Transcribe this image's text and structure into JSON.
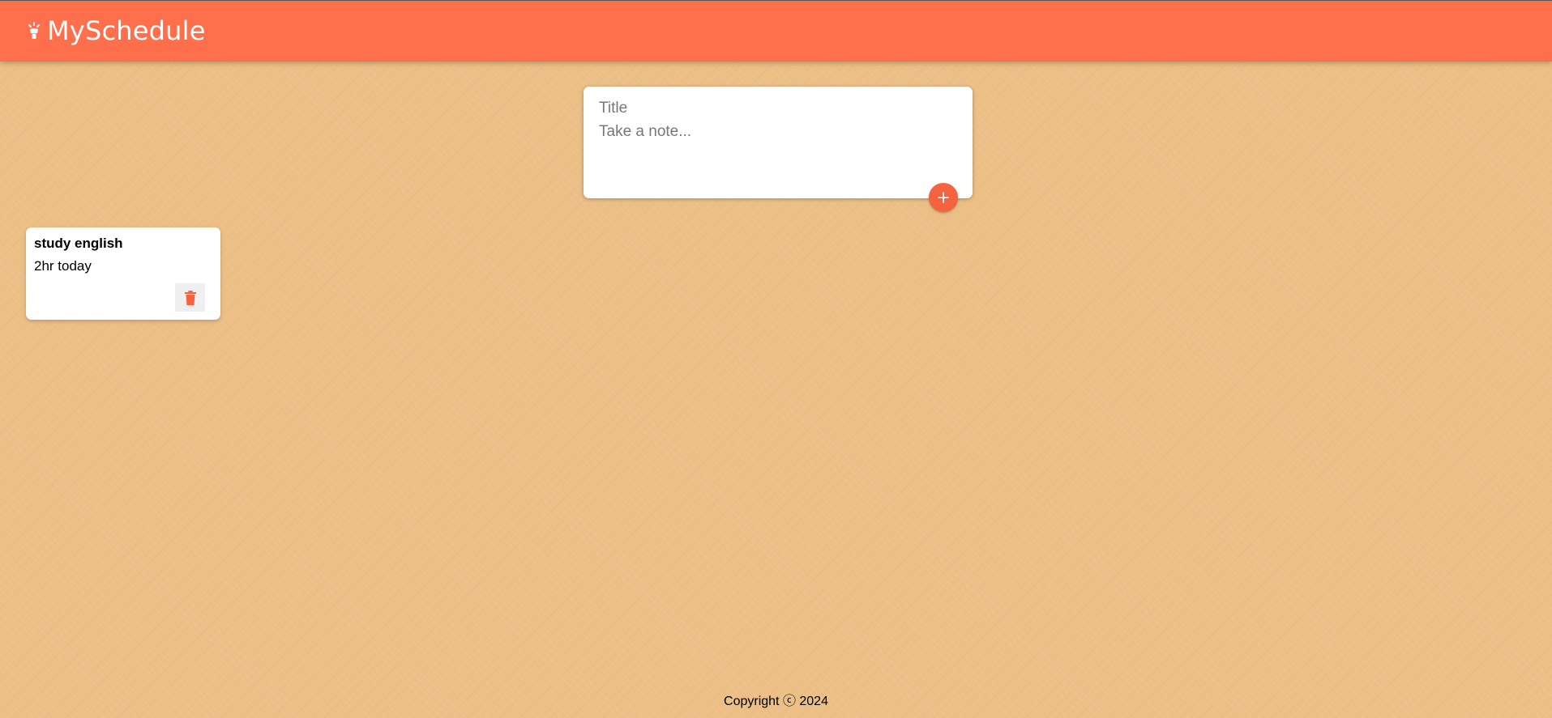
{
  "header": {
    "title": "MySchedule",
    "icon": "lightbulb-icon"
  },
  "create_form": {
    "title_placeholder": "Title",
    "content_placeholder": "Take a note...",
    "add_icon": "plus-icon"
  },
  "notes": [
    {
      "title": "study english",
      "content": "2hr today",
      "delete_icon": "trash-icon"
    }
  ],
  "footer": {
    "copyright": "Copyright ⓒ 2024"
  },
  "colors": {
    "accent": "#ff6f4b",
    "button": "#f5623f",
    "background": "#ecbf86"
  }
}
